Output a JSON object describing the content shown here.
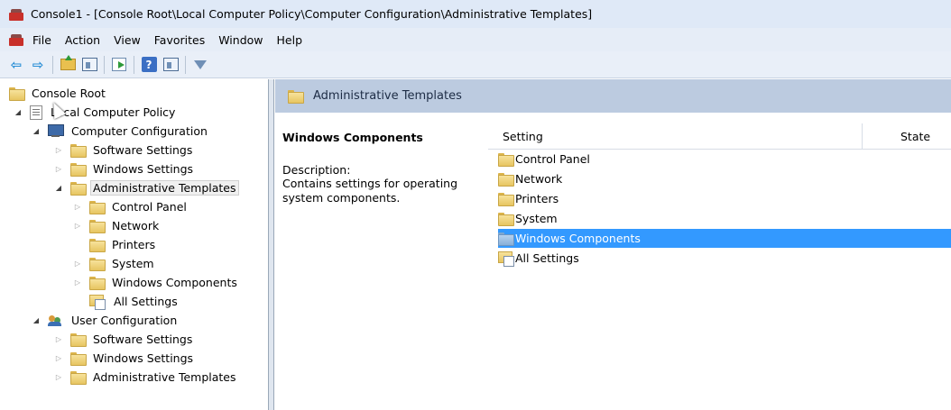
{
  "window": {
    "title": "Console1 - [Console Root\\Local Computer Policy\\Computer Configuration\\Administrative Templates]"
  },
  "menu": [
    "File",
    "Action",
    "View",
    "Favorites",
    "Window",
    "Help"
  ],
  "toolbar": {
    "icons": [
      "back-arrow-icon",
      "forward-arrow-icon",
      "up-folder-icon",
      "show-hide-tree-icon",
      "export-list-icon",
      "help-icon",
      "action-pane-icon",
      "filter-icon"
    ]
  },
  "tree": {
    "console_root": "Console Root",
    "local_computer_policy": "Local Computer Policy",
    "computer_configuration": "Computer Configuration",
    "cc_software_settings": "Software Settings",
    "cc_windows_settings": "Windows Settings",
    "cc_administrative_templates": "Administrative Templates",
    "control_panel": "Control Panel",
    "network": "Network",
    "printers": "Printers",
    "system": "System",
    "windows_components": "Windows Components",
    "all_settings": "All Settings",
    "user_configuration": "User Configuration",
    "uc_software_settings": "Software Settings",
    "uc_windows_settings": "Windows Settings",
    "uc_administrative_templates": "Administrative Templates"
  },
  "right_header": {
    "title": "Administrative Templates"
  },
  "description": {
    "title": "Windows Components",
    "label": "Description:",
    "text": "Contains settings for operating system components."
  },
  "list": {
    "columns": {
      "setting": "Setting",
      "state": "State"
    },
    "items": [
      "Control Panel",
      "Network",
      "Printers",
      "System",
      "Windows Components",
      "All Settings"
    ],
    "selected_item": "Windows Components"
  },
  "colors": {
    "selection": "#3399ff",
    "header_band": "#bccbe0",
    "folder": "#e7c561"
  }
}
